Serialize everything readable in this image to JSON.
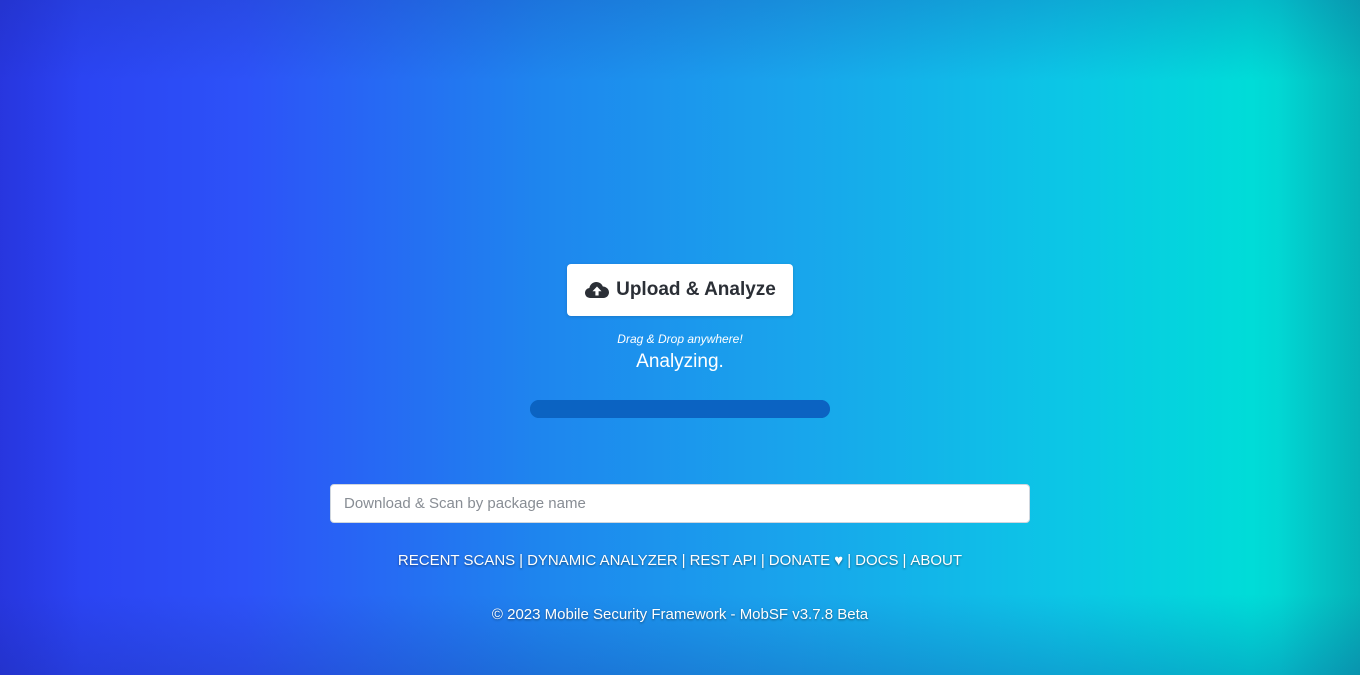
{
  "colors": {
    "bg_left": "#2d52f8",
    "bg_mid": "#19a4ec",
    "bg_right": "#00dcd8",
    "button_bg": "#ffffff",
    "button_text": "#2b2f36",
    "progress_bar": "#0b63c2"
  },
  "upload": {
    "icon": "cloud-upload-icon",
    "label": "Upload & Analyze",
    "drag_hint": "Drag & Drop anywhere!",
    "status": "Analyzing."
  },
  "progress": {
    "value_percent": 100
  },
  "search": {
    "placeholder": "Download & Scan by package name",
    "value": ""
  },
  "footer": {
    "links": {
      "recent_scans": "RECENT SCANS",
      "dynamic_analyzer": "DYNAMIC ANALYZER",
      "rest_api": "REST API",
      "donate": "DONATE ♥",
      "docs": "DOCS",
      "about": "ABOUT"
    },
    "separator": "|",
    "copyright": "© 2023 Mobile Security Framework - MobSF v3.7.8 Beta"
  }
}
